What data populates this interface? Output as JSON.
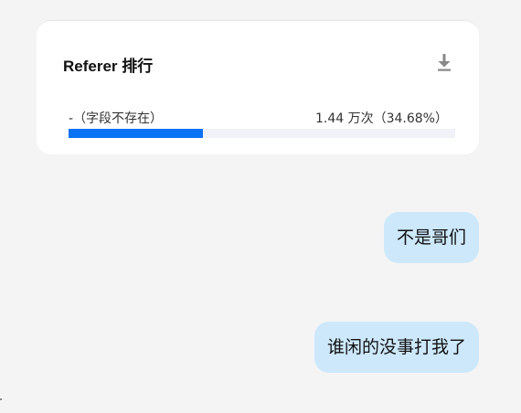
{
  "card": {
    "title": "Referer 排行",
    "download_icon": "download-icon",
    "rows": [
      {
        "label": "-（字段不存在）",
        "value": "1.44 万次（34.68%）",
        "share": 0.3468
      }
    ]
  },
  "messages": [
    {
      "text": "不是哥们"
    },
    {
      "text": "谁闲的没事打我了"
    }
  ],
  "colors": {
    "background": "#f4f4f5",
    "card": "#ffffff",
    "bar_fill": "#0a72f5",
    "bar_track": "#f0f2f8",
    "bubble": "#cde8fb",
    "icon": "#888888"
  }
}
